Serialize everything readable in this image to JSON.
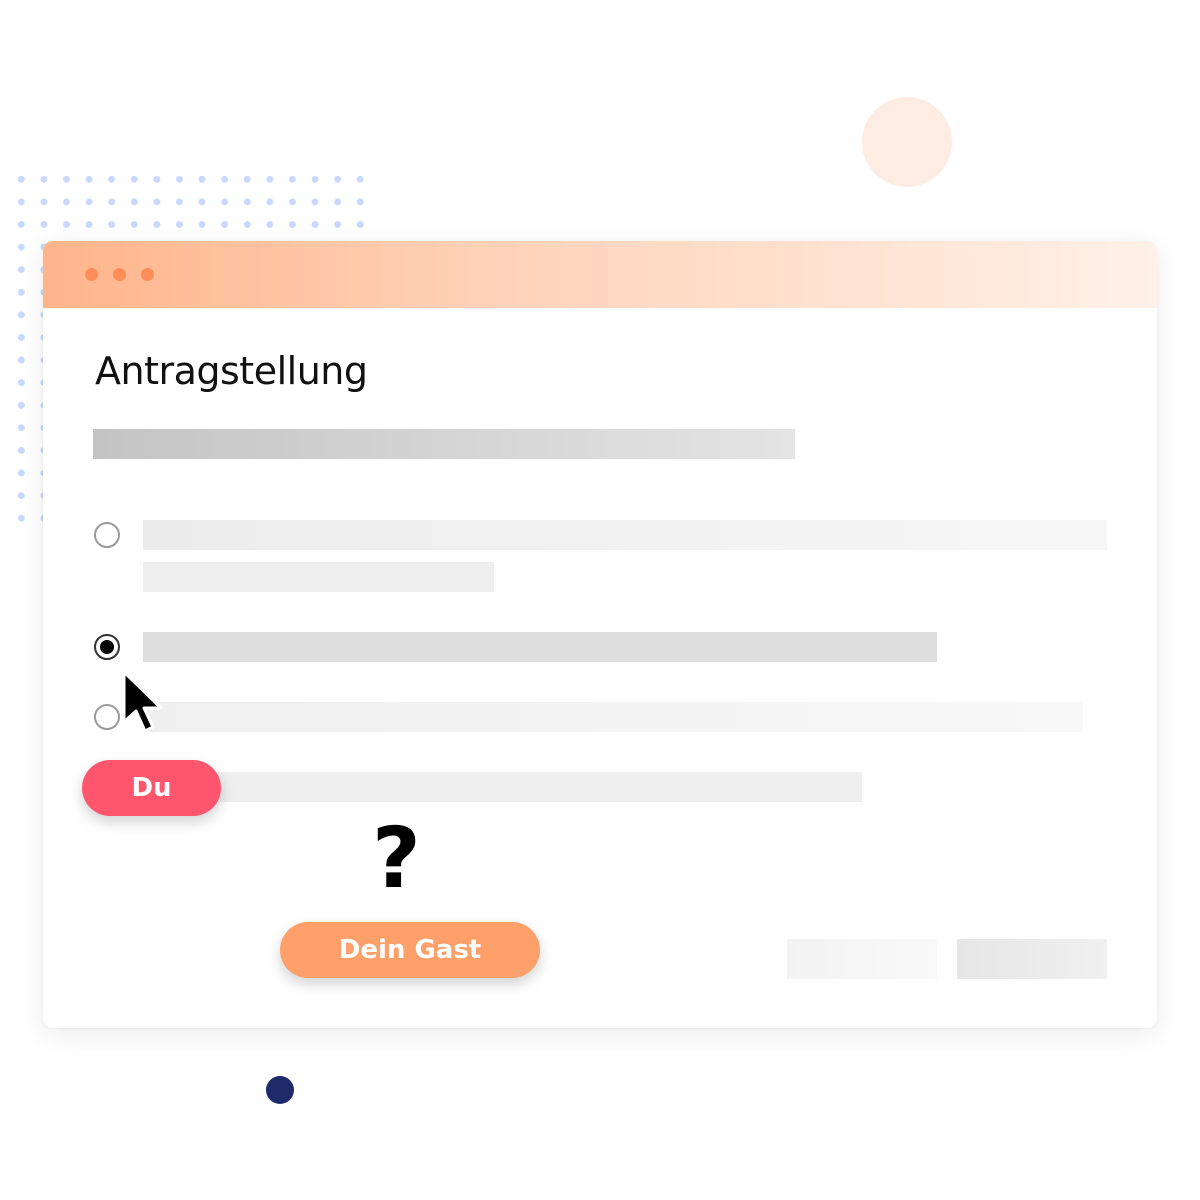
{
  "form": {
    "title": "Antragstellung"
  },
  "badges": {
    "you_label": "Du",
    "guest_label": "Dein Gast"
  },
  "question_mark": "?",
  "options": [
    {
      "selected": false
    },
    {
      "selected": true
    },
    {
      "selected": false
    }
  ],
  "icons": {
    "window_controls": "traffic-light-dots",
    "pointer": "mouse-cursor-icon"
  },
  "colors": {
    "titlebar_start": "#ffb48a",
    "titlebar_end": "#fff1e8",
    "window_dot": "#ff8d5a",
    "you_badge": "#ff566e",
    "guest_badge": "#ffa06b",
    "decor_navy": "#1f2a6b",
    "decor_peach": "#fdece2",
    "decor_dots": "#c9d8ff"
  }
}
